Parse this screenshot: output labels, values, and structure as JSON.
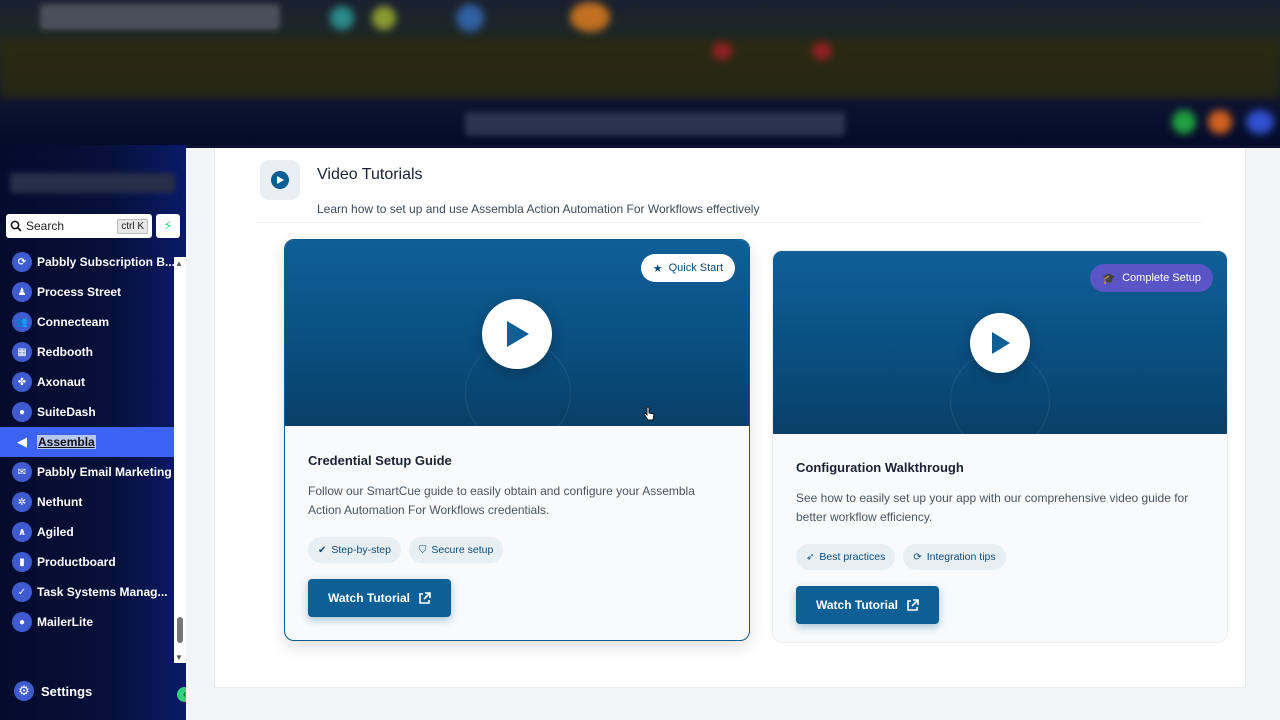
{
  "sidebar": {
    "search_label": "Search",
    "search_shortcut": "ctrl K",
    "items": [
      {
        "label": "Pabbly Subscription B...",
        "icon": "subscription-icon",
        "glyph": "⟳"
      },
      {
        "label": "Process Street",
        "icon": "process-icon",
        "glyph": "♟"
      },
      {
        "label": "Connecteam",
        "icon": "team-icon",
        "glyph": "👥"
      },
      {
        "label": "Redbooth",
        "icon": "grid-icon",
        "glyph": "▦"
      },
      {
        "label": "Axonaut",
        "icon": "leaf-icon",
        "glyph": "✤"
      },
      {
        "label": "SuiteDash",
        "icon": "user-icon",
        "glyph": "●"
      },
      {
        "label": "Assembla",
        "icon": "speaker-icon",
        "glyph": "◀",
        "active": true
      },
      {
        "label": "Pabbly Email Marketing",
        "icon": "mail-icon",
        "glyph": "✉"
      },
      {
        "label": "Nethunt",
        "icon": "hunt-icon",
        "glyph": "✲"
      },
      {
        "label": "Agiled",
        "icon": "pulse-icon",
        "glyph": "∧"
      },
      {
        "label": "Productboard",
        "icon": "board-icon",
        "glyph": "▮"
      },
      {
        "label": "Task Systems Manag...",
        "icon": "check-icon",
        "glyph": "✓"
      },
      {
        "label": "MailerLite",
        "icon": "mailerlite-icon",
        "glyph": "●"
      }
    ],
    "settings_label": "Settings"
  },
  "section": {
    "title": "Video Tutorials",
    "subtitle": "Learn how to set up and use Assembla Action Automation For Workflows effectively"
  },
  "cards": [
    {
      "badge": "Quick Start",
      "title": "Credential Setup Guide",
      "description": "Follow our SmartCue guide to easily obtain and configure your Assembla Action Automation For Workflows credentials.",
      "tags": [
        "Step-by-step",
        "Secure setup"
      ],
      "button": "Watch Tutorial"
    },
    {
      "badge": "Complete Setup",
      "title": "Configuration Walkthrough",
      "description": "See how to easily set up your app with our comprehensive video guide for better workflow efficiency.",
      "tags": [
        "Best practices",
        "Integration tips"
      ],
      "button": "Watch Tutorial"
    }
  ],
  "colors": {
    "primary": "#0d5f95",
    "sidebar_active": "#3d63f5",
    "badge_purple": "#5a55c6"
  }
}
